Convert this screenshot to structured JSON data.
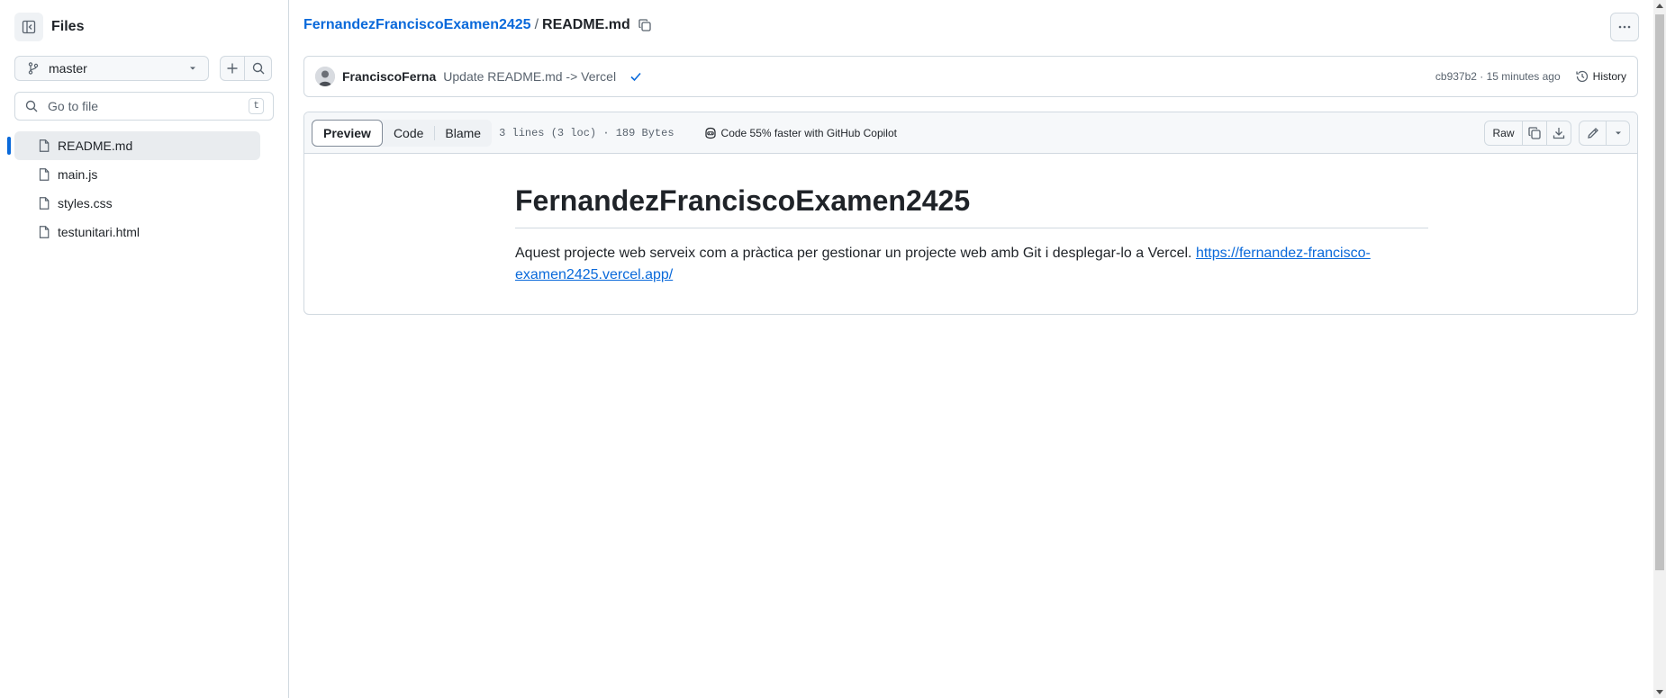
{
  "sidebar": {
    "title": "Files",
    "branch": "master",
    "goto_placeholder": "Go to file",
    "goto_shortcut": "t",
    "files": [
      {
        "name": "README.md",
        "active": true
      },
      {
        "name": "main.js",
        "active": false
      },
      {
        "name": "styles.css",
        "active": false
      },
      {
        "name": "testunitari.html",
        "active": false
      }
    ]
  },
  "breadcrumb": {
    "repo": "FernandezFranciscoExamen2425",
    "separator": "/",
    "file": "README.md"
  },
  "commit": {
    "author": "FranciscoFerna",
    "message": "Update README.md -> Vercel",
    "meta": "cb937b2 · 15 minutes ago",
    "history_label": "History"
  },
  "file_header": {
    "tabs": [
      "Preview",
      "Code",
      "Blame"
    ],
    "stats": "3 lines (3 loc) · 189 Bytes",
    "copilot": "Code 55% faster with GitHub Copilot",
    "raw_label": "Raw"
  },
  "readme": {
    "heading": "FernandezFranciscoExamen2425",
    "text": "Aquest projecte web serveix com a pràctica per gestionar un projecte web amb Git i desplegar-lo a Vercel. ",
    "link": "https://fernandez-francisco-examen2425.vercel.app/"
  },
  "colors": {
    "accent": "#0969da",
    "border": "#d1d9e0",
    "muted": "#59636e",
    "text": "#1f2328"
  }
}
